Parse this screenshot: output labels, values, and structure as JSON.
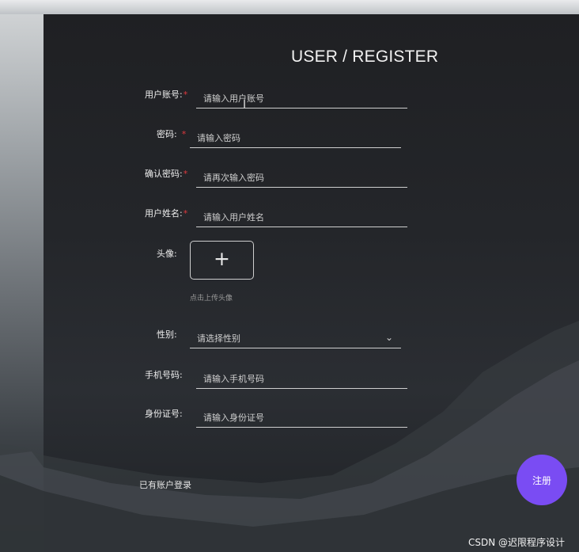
{
  "title": "USER / REGISTER",
  "fields": [
    {
      "label": "用户账号:",
      "placeholder": "请输入用户账号",
      "required": true
    },
    {
      "label": "密码:",
      "placeholder": "请输入密码",
      "required": true
    },
    {
      "label": "确认密码:",
      "placeholder": "请再次输入密码",
      "required": true
    },
    {
      "label": "用户姓名:",
      "placeholder": "请输入用户姓名",
      "required": true
    }
  ],
  "avatar": {
    "label": "头像:",
    "hint": "点击上传头像"
  },
  "gender": {
    "label": "性别:",
    "placeholder": "请选择性别"
  },
  "phone": {
    "label": "手机号码:",
    "placeholder": "请输入手机号码"
  },
  "idcard": {
    "label": "身份证号:",
    "placeholder": "请输入身份证号"
  },
  "login_link": "已有账户登录",
  "register_button": "注册",
  "watermark": "CSDN @迟限程序设计",
  "required_mark": "*",
  "icons": {
    "upload": "plus-icon",
    "select": "chevron-down-icon"
  },
  "colors": {
    "accent": "#7a4cf3",
    "required": "#e0393e"
  }
}
